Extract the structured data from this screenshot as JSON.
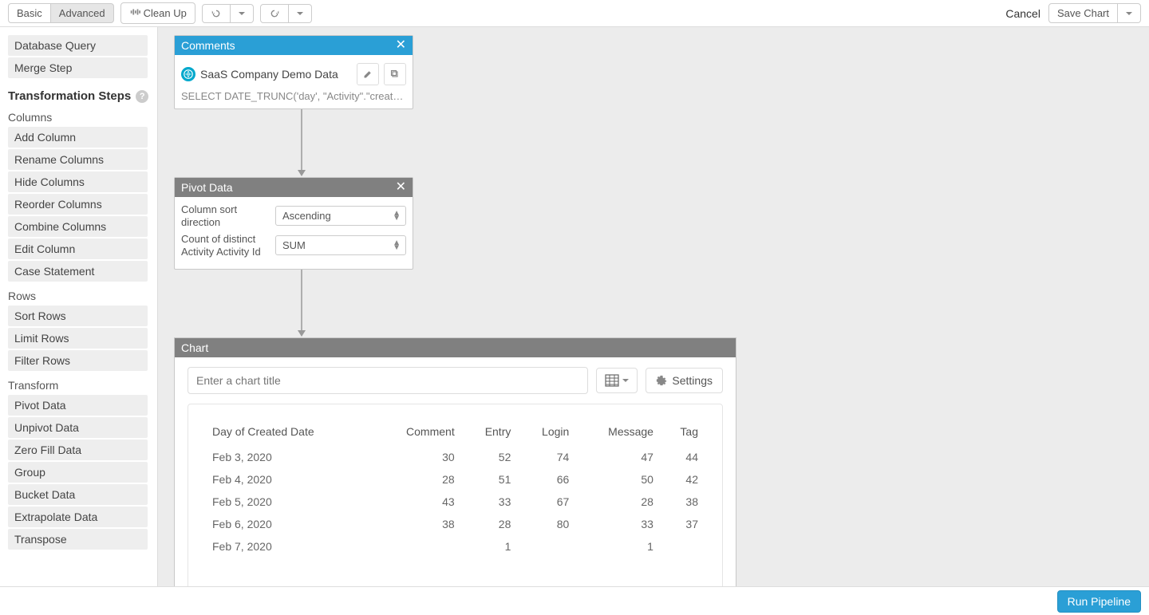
{
  "toolbar": {
    "basic": "Basic",
    "advanced": "Advanced",
    "cleanup": "Clean Up",
    "cancel": "Cancel",
    "save_chart": "Save Chart"
  },
  "sidebar": {
    "db_query": "Database Query",
    "merge": "Merge Step",
    "transformation_heading": "Transformation Steps",
    "columns_heading": "Columns",
    "columns": [
      "Add Column",
      "Rename Columns",
      "Hide Columns",
      "Reorder Columns",
      "Combine Columns",
      "Edit Column",
      "Case Statement"
    ],
    "rows_heading": "Rows",
    "rows": [
      "Sort Rows",
      "Limit Rows",
      "Filter Rows"
    ],
    "transform_heading": "Transform",
    "transform": [
      "Pivot Data",
      "Unpivot Data",
      "Zero Fill Data",
      "Group",
      "Bucket Data",
      "Extrapolate Data",
      "Transpose"
    ]
  },
  "comments_node": {
    "title": "Comments",
    "datasource": "SaaS Company Demo Data",
    "sql_preview": "SELECT DATE_TRUNC('day', \"Activity\".\"created_da..."
  },
  "pivot_node": {
    "title": "Pivot Data",
    "label1": "Column sort direction",
    "value1": "Ascending",
    "label2": "Count of distinct Activity Activity Id",
    "value2": "SUM"
  },
  "chart_node": {
    "title": "Chart",
    "title_placeholder": "Enter a chart title",
    "settings": "Settings"
  },
  "chart_data": {
    "type": "table",
    "columns": [
      "Day of Created Date",
      "Comment",
      "Entry",
      "Login",
      "Message",
      "Tag"
    ],
    "rows": [
      [
        "Feb 3, 2020",
        "30",
        "52",
        "74",
        "47",
        "44"
      ],
      [
        "Feb 4, 2020",
        "28",
        "51",
        "66",
        "50",
        "42"
      ],
      [
        "Feb 5, 2020",
        "43",
        "33",
        "67",
        "28",
        "38"
      ],
      [
        "Feb 6, 2020",
        "38",
        "28",
        "80",
        "33",
        "37"
      ],
      [
        "Feb 7, 2020",
        "",
        "1",
        "",
        "1",
        ""
      ]
    ]
  },
  "footer": {
    "run": "Run Pipeline"
  }
}
